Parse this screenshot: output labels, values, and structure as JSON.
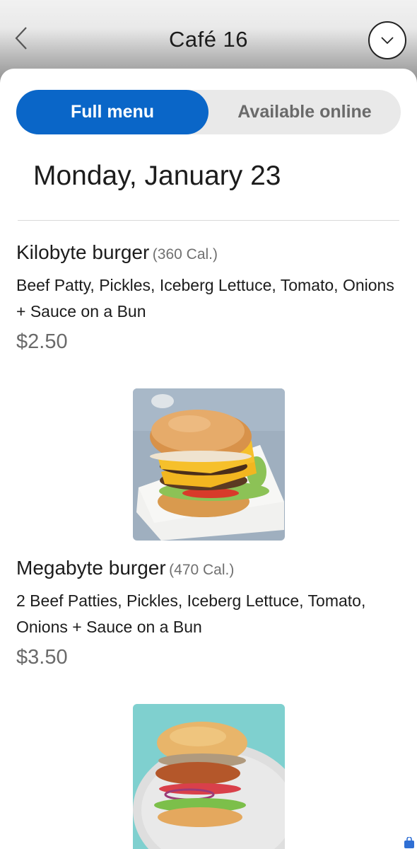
{
  "header": {
    "title": "Café 16",
    "back_icon": "chevron-left-icon",
    "dropdown_icon": "chevron-down-icon"
  },
  "tabs": {
    "full_menu": "Full menu",
    "available_online": "Available online",
    "active": "full_menu",
    "active_color": "#0a66c8"
  },
  "date": "Monday, January 23",
  "items": [
    {
      "name": "Kilobyte burger",
      "calories": "(360 Cal.)",
      "description": "Beef Patty, Pickles, Iceberg Lettuce, Tomato, Onions + Sauce on a Bun",
      "price": "$2.50"
    },
    {
      "name": "Megabyte burger",
      "calories": "(470 Cal.)",
      "description": "2 Beef Patties, Pickles, Iceberg Lettuce, Tomato, Onions + Sauce on a Bun",
      "price": "$3.50"
    }
  ],
  "footer": {
    "icon": "shopping-bag-icon"
  }
}
